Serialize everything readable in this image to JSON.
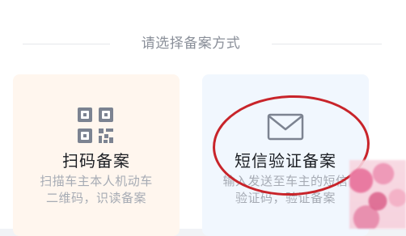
{
  "section": {
    "title": "请选择备案方式"
  },
  "options": [
    {
      "icon": "qr-code-icon",
      "title": "扫码备案",
      "desc_line1": "扫描车主本人机动车",
      "desc_line2": "二维码，识读备案",
      "background": "#fff6ee",
      "icon_color": "#7c8391"
    },
    {
      "icon": "envelope-icon",
      "title": "短信验证备案",
      "desc_line1": "输入发送至车主的短信",
      "desc_line2": "验证码，验证备案",
      "background": "#f1f7fe",
      "icon_color": "#7c8391"
    }
  ],
  "annotation": {
    "ellipse_color": "#c8242a",
    "blurred_patch_color": "#e76a96"
  }
}
